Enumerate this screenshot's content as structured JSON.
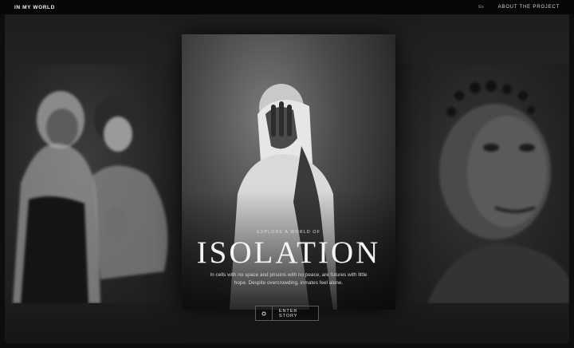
{
  "header": {
    "logo": "IN MY WORLD",
    "lang": "Es",
    "about": "ABOUT THE PROJECT"
  },
  "featured": {
    "eyebrow": "EXPLORE A WORLD OF",
    "title": "ISOLATION",
    "description": "In cells with no space and prisons with no peace, are futures with little hope. Despite overcrowding, inmates feel alone.",
    "button_label": "ENTER STORY",
    "button_icon": "circle-icon"
  },
  "colors": {
    "background": "#0d0d0d",
    "text": "#f4f4f4",
    "border": "#5a5a5a"
  }
}
